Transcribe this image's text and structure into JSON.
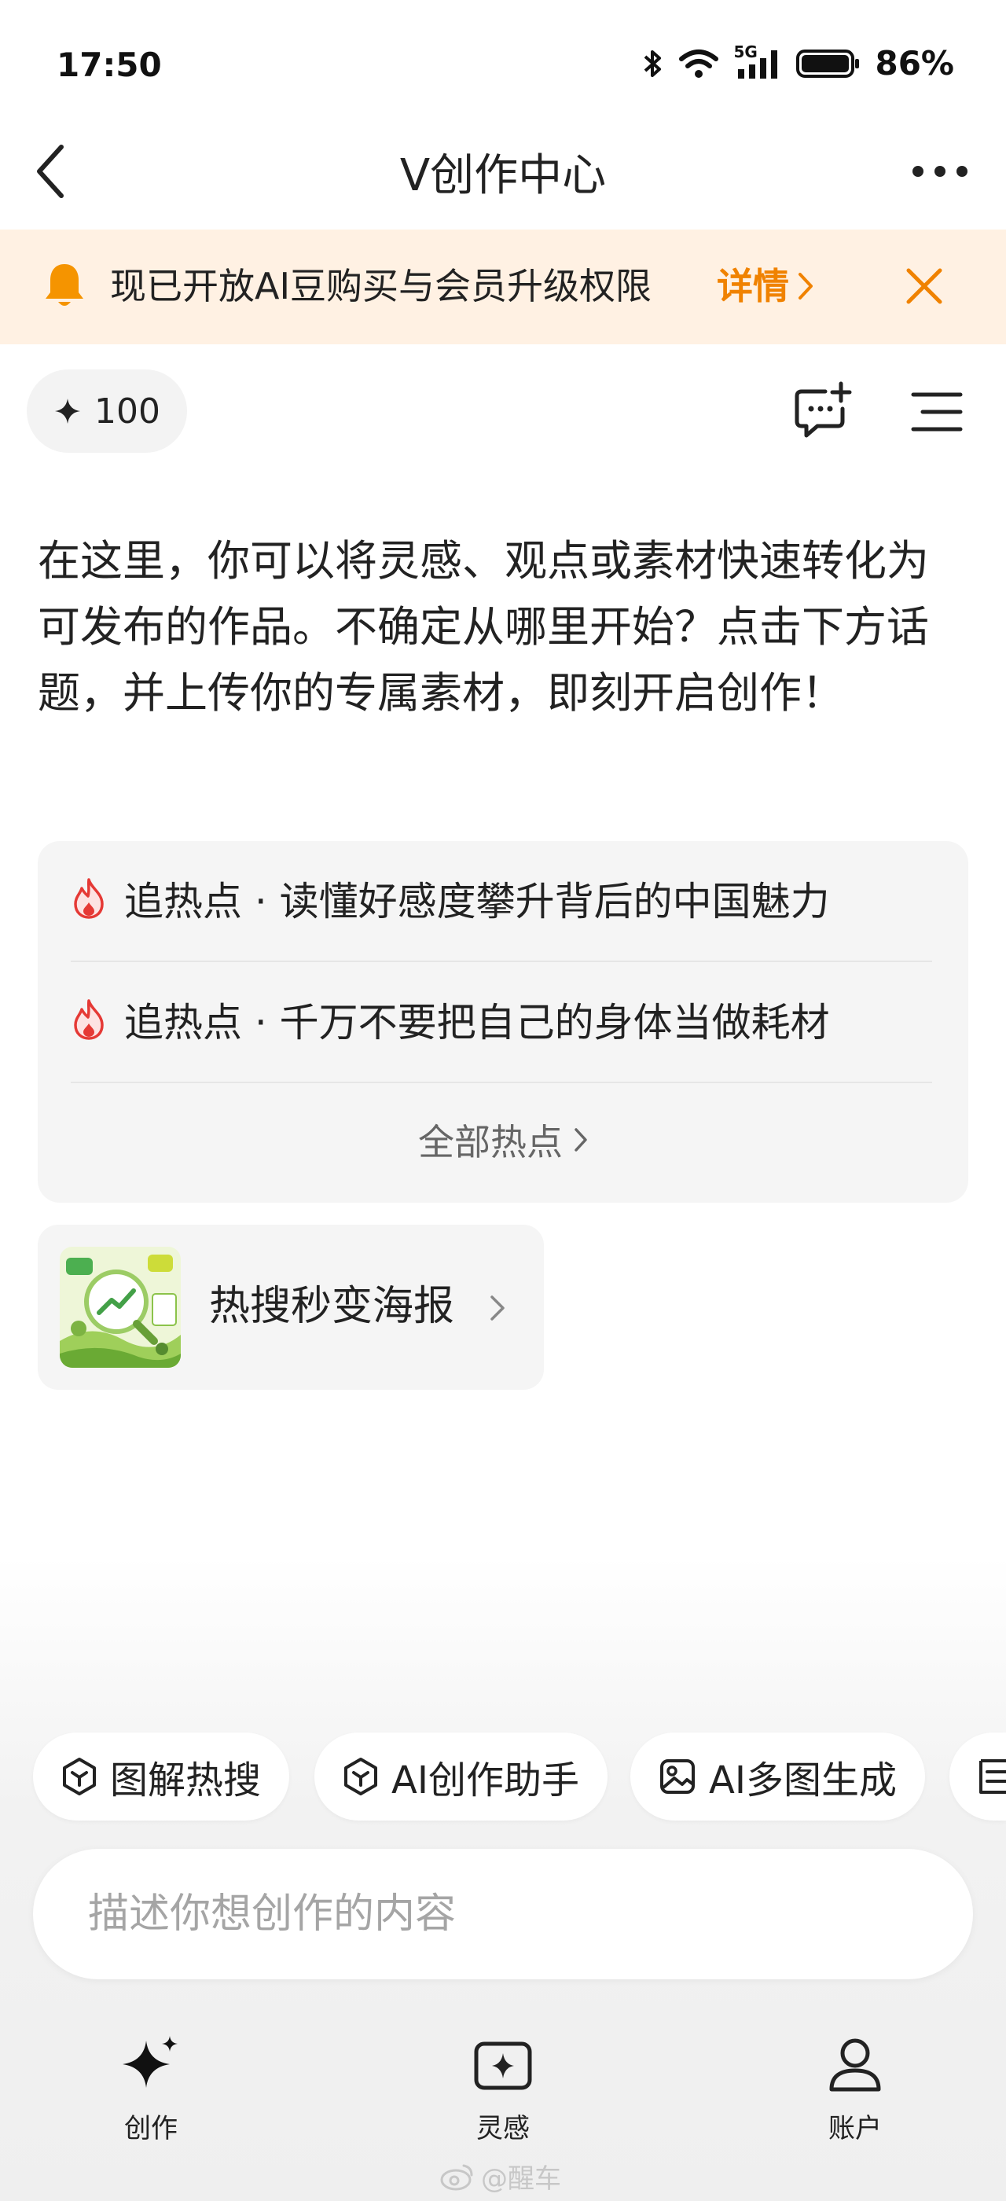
{
  "status_bar": {
    "time": "17:50",
    "network_label": "5G",
    "battery": "86%"
  },
  "header": {
    "title": "V创作中心",
    "back_icon": "chevron-left-icon",
    "more_icon": "more-horizontal-icon"
  },
  "notice": {
    "text": "现已开放AI豆购买与会员升级权限",
    "detail_label": "详情",
    "accent_color": "#f08200",
    "background": "#fff1e3"
  },
  "toolbar": {
    "points": "100"
  },
  "intro": {
    "text": "在这里，你可以将灵感、观点或素材快速转化为可发布的作品。不确定从哪里开始？点击下方话题，并上传你的专属素材，即刻开启创作！"
  },
  "hot_topics": {
    "items": [
      {
        "label": "追热点 · 读懂好感度攀升背后的中国魅力"
      },
      {
        "label": "追热点 · 千万不要把自己的身体当做耗材"
      }
    ],
    "all_label": "全部热点"
  },
  "poster": {
    "label": "热搜秒变海报"
  },
  "chips": [
    {
      "label": "图解热搜",
      "icon": "hexagon-cube-icon"
    },
    {
      "label": "AI创作助手",
      "icon": "hexagon-cube-icon"
    },
    {
      "label": "AI多图生成",
      "icon": "image-icon"
    },
    {
      "label": "",
      "icon": "document-icon"
    }
  ],
  "input": {
    "placeholder": "描述你想创作的内容"
  },
  "bottom_nav": [
    {
      "label": "创作",
      "icon": "sparkle-icon",
      "active": true
    },
    {
      "label": "灵感",
      "icon": "inspiration-icon",
      "active": false
    },
    {
      "label": "账户",
      "icon": "user-icon",
      "active": false
    }
  ],
  "watermark": {
    "text": "@醒车"
  }
}
